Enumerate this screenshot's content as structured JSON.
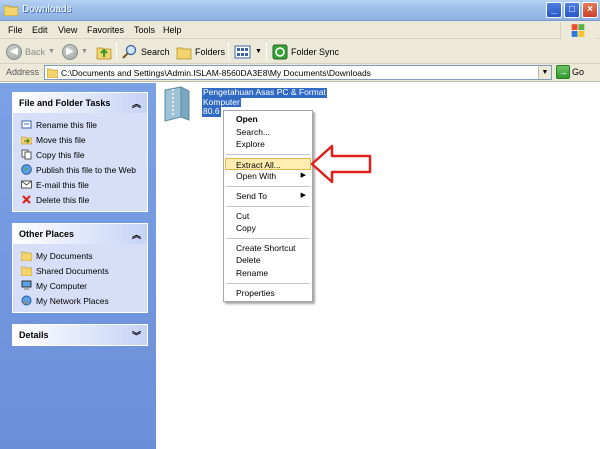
{
  "window": {
    "title": "Downloads"
  },
  "menu": [
    "File",
    "Edit",
    "View",
    "Favorites",
    "Tools",
    "Help"
  ],
  "toolbar": {
    "back": "Back",
    "search": "Search",
    "folders": "Folders",
    "folder_sync": "Folder Sync"
  },
  "address": {
    "label": "Address",
    "path": "C:\\Documents and Settings\\Admin.ISLAM-8560DA3E8\\My Documents\\Downloads",
    "go": "Go"
  },
  "file_tasks": {
    "title": "File and Folder Tasks",
    "items": [
      {
        "label": "Rename this file",
        "icon": "rename-icon"
      },
      {
        "label": "Move this file",
        "icon": "move-icon"
      },
      {
        "label": "Copy this file",
        "icon": "copy-icon"
      },
      {
        "label": "Publish this file to the Web",
        "icon": "globe-icon"
      },
      {
        "label": "E-mail this file",
        "icon": "email-icon"
      },
      {
        "label": "Delete this file",
        "icon": "delete-icon"
      }
    ]
  },
  "other_places": {
    "title": "Other Places",
    "items": [
      {
        "label": "My Documents",
        "icon": "folder-icon"
      },
      {
        "label": "Shared Documents",
        "icon": "folder-icon"
      },
      {
        "label": "My Computer",
        "icon": "computer-icon"
      },
      {
        "label": "My Network Places",
        "icon": "network-icon"
      }
    ]
  },
  "details": {
    "title": "Details"
  },
  "file": {
    "name_line1": "Pengetahuan Asas PC & Format",
    "name_line2": "Komputer",
    "size": "80.6"
  },
  "context_menu": {
    "open": "Open",
    "search": "Search...",
    "explore": "Explore",
    "extract_all": "Extract All...",
    "open_with": "Open With",
    "send_to": "Send To",
    "cut": "Cut",
    "copy": "Copy",
    "create_shortcut": "Create Shortcut",
    "delete": "Delete",
    "rename": "Rename",
    "properties": "Properties"
  },
  "colors": {
    "selection": "#316ac5",
    "highlight": "#ffeeb0",
    "arrow": "#e0201c",
    "sidebar": "#7aa1e6"
  }
}
